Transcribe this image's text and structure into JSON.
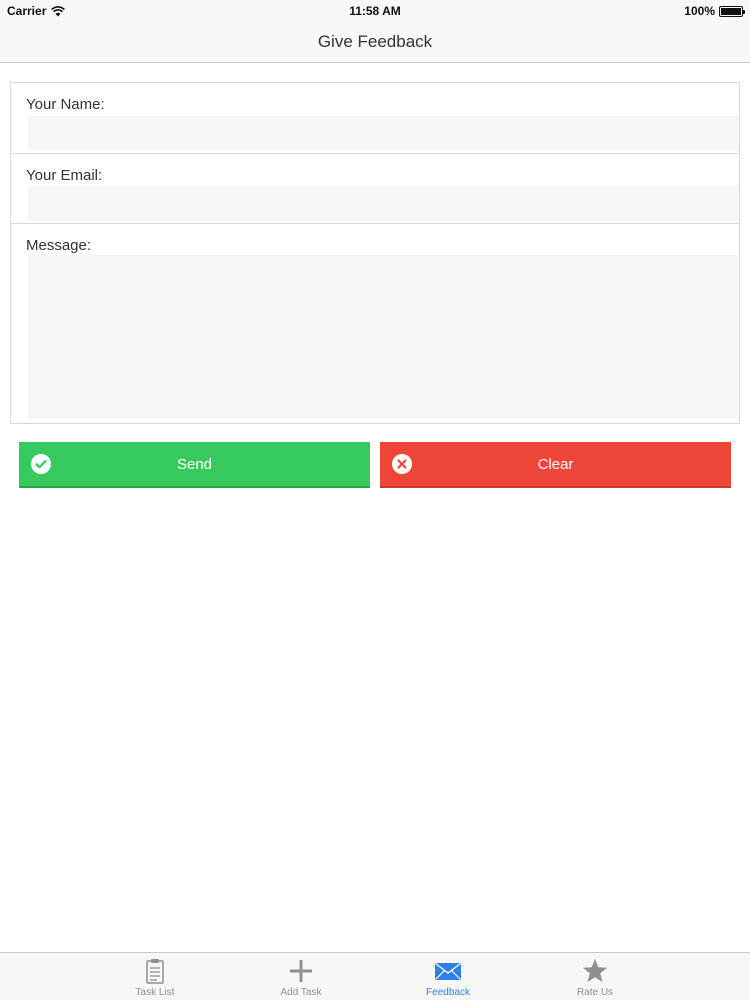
{
  "status_bar": {
    "carrier": "Carrier",
    "time": "11:58 AM",
    "battery": "100%",
    "battery_level": 1.0
  },
  "nav": {
    "title": "Give Feedback"
  },
  "form": {
    "name_label": "Your Name:",
    "name_value": "",
    "email_label": "Your Email:",
    "email_value": "",
    "message_label": "Message:",
    "message_value": ""
  },
  "buttons": {
    "send_label": "Send",
    "send_icon": "check-circle-icon",
    "send_color": "#37c95d",
    "clear_label": "Clear",
    "clear_icon": "x-circle-icon",
    "clear_color": "#ef4539"
  },
  "tab_bar": {
    "active_color": "#2f7fe5",
    "inactive_color": "#8e8e93",
    "tabs": [
      {
        "label": "Task List",
        "icon": "clipboard-icon"
      },
      {
        "label": "Add Task",
        "icon": "plus-icon"
      },
      {
        "label": "Feedback",
        "icon": "envelope-icon",
        "active": true
      },
      {
        "label": "Rate Us",
        "icon": "star-icon"
      }
    ]
  }
}
